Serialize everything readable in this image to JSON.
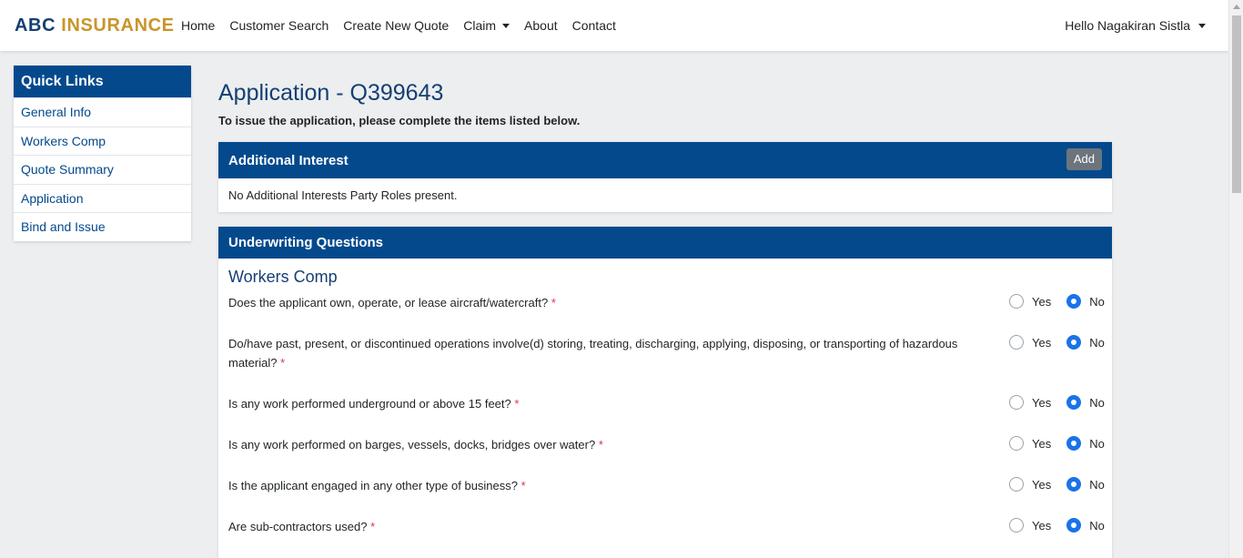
{
  "brand": {
    "part1": "ABC ",
    "part2": "INSURANCE"
  },
  "nav": {
    "home": "Home",
    "customer_search": "Customer Search",
    "create_new_quote": "Create New Quote",
    "claim": "Claim",
    "about": "About",
    "contact": "Contact",
    "user_greeting": "Hello Nagakiran Sistla"
  },
  "sidebar": {
    "title": "Quick Links",
    "items": [
      {
        "label": "General Info"
      },
      {
        "label": "Workers Comp"
      },
      {
        "label": "Quote Summary"
      },
      {
        "label": "Application"
      },
      {
        "label": "Bind and Issue"
      }
    ]
  },
  "page": {
    "title": "Application - Q399643",
    "subtitle": "To issue the application, please complete the items listed below."
  },
  "additional_interest": {
    "title": "Additional Interest",
    "add_label": "Add",
    "empty_text": "No Additional Interests Party Roles present."
  },
  "underwriting": {
    "title": "Underwriting Questions",
    "section": "Workers Comp",
    "yes_label": "Yes",
    "no_label": "No",
    "required_mark": "*",
    "questions": [
      {
        "text": "Does the applicant own, operate, or lease aircraft/watercraft?",
        "answer": "No"
      },
      {
        "text": "Do/have past, present, or discontinued operations involve(d) storing, treating, discharging, applying, disposing, or transporting of hazardous material?",
        "answer": "No"
      },
      {
        "text": "Is any work performed underground or above 15 feet?",
        "answer": "No"
      },
      {
        "text": "Is any work performed on barges, vessels, docks, bridges over water?",
        "answer": "No"
      },
      {
        "text": "Is the applicant engaged in any other type of business?",
        "answer": "No"
      },
      {
        "text": "Are sub-contractors used?",
        "answer": "No"
      }
    ]
  },
  "colors": {
    "primary": "#03498c",
    "brand_blue": "#153f73",
    "brand_gold": "#c9952a",
    "radio_checked": "#1a73e8",
    "required": "#dc3545"
  }
}
